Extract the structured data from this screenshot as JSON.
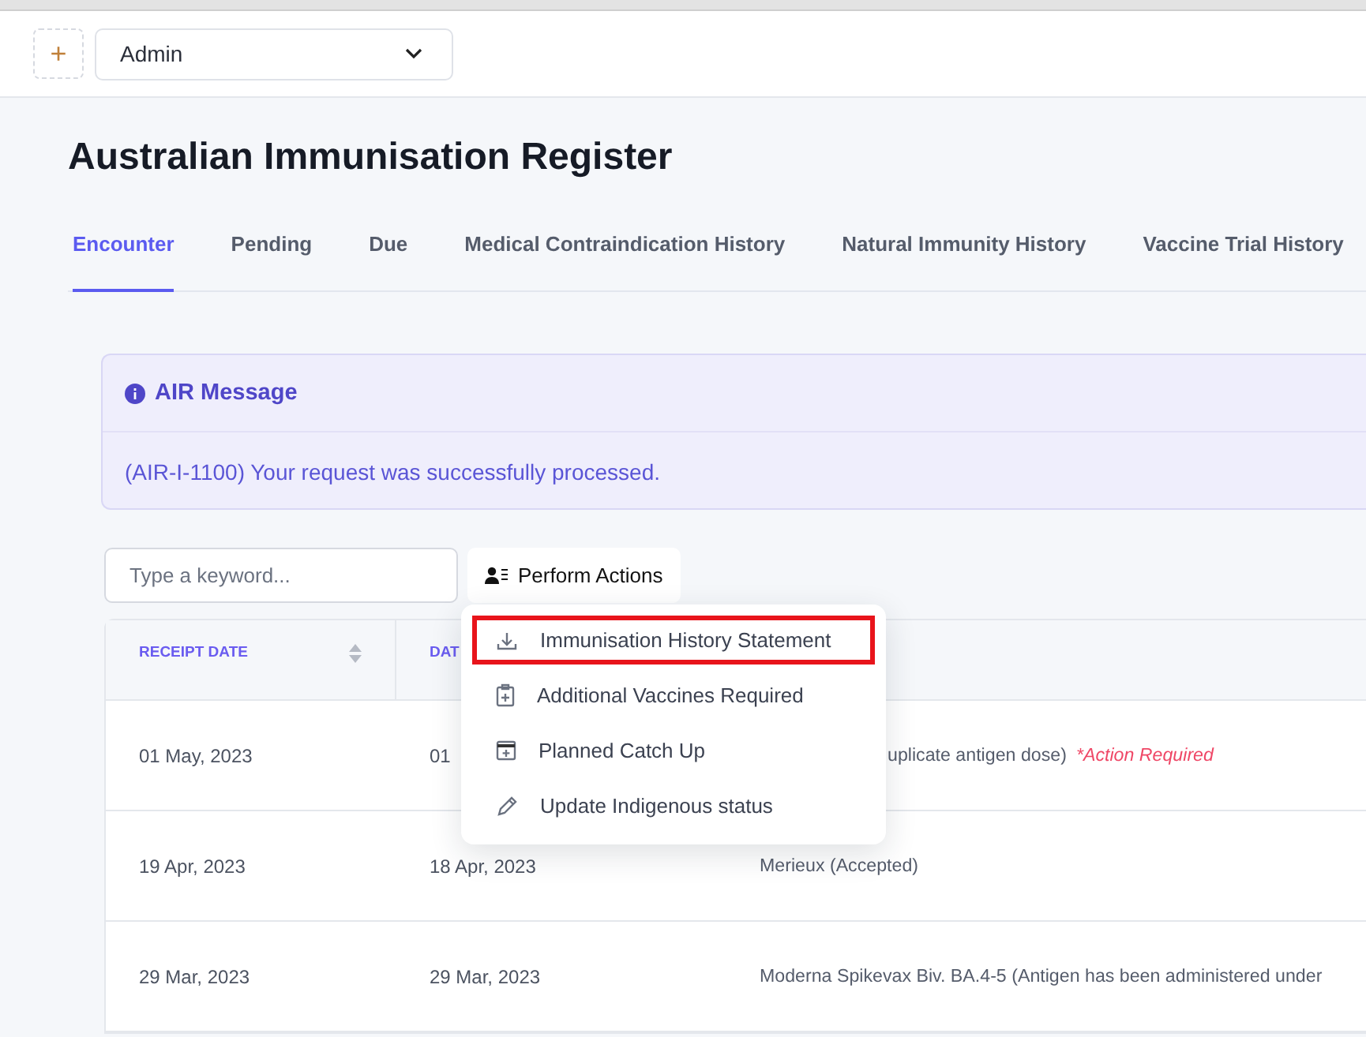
{
  "topbar": {
    "add_label": "+",
    "role_select": {
      "value": "Admin"
    }
  },
  "page_title": "Australian Immunisation Register",
  "tabs": [
    {
      "label": "Encounter",
      "selected": true
    },
    {
      "label": "Pending",
      "selected": false
    },
    {
      "label": "Due",
      "selected": false
    },
    {
      "label": "Medical Contraindication History",
      "selected": false
    },
    {
      "label": "Natural Immunity History",
      "selected": false
    },
    {
      "label": "Vaccine Trial History",
      "selected": false
    }
  ],
  "message": {
    "title": "AIR Message",
    "text": "(AIR-I-1100) Your request was successfully processed."
  },
  "search": {
    "placeholder": "Type a keyword..."
  },
  "actions_button": {
    "label": "Perform Actions"
  },
  "actions_menu": [
    {
      "kind": "download",
      "label": "Immunisation History Statement",
      "highlighted": true
    },
    {
      "kind": "clipboard",
      "label": "Additional Vaccines Required",
      "highlighted": false
    },
    {
      "kind": "calendar",
      "label": "Planned Catch Up",
      "highlighted": false
    },
    {
      "kind": "pencil",
      "label": "Update Indigenous status",
      "highlighted": false
    }
  ],
  "table": {
    "columns": [
      "RECEIPT DATE",
      "DAT"
    ],
    "rows": [
      {
        "receipt_date": "01 May, 2023",
        "date": "01",
        "description": "uplicate antigen dose)",
        "note": "*Action Required",
        "description_hidden_start": true
      },
      {
        "receipt_date": "19 Apr, 2023",
        "date": "18 Apr, 2023",
        "description": "Merieux (Accepted)",
        "description_hidden_start": false
      },
      {
        "receipt_date": "29 Mar, 2023",
        "date": "29 Mar, 2023",
        "description": "Moderna Spikevax Biv. BA.4-5 (Antigen has been administered under",
        "description_hidden_start": false
      }
    ]
  }
}
